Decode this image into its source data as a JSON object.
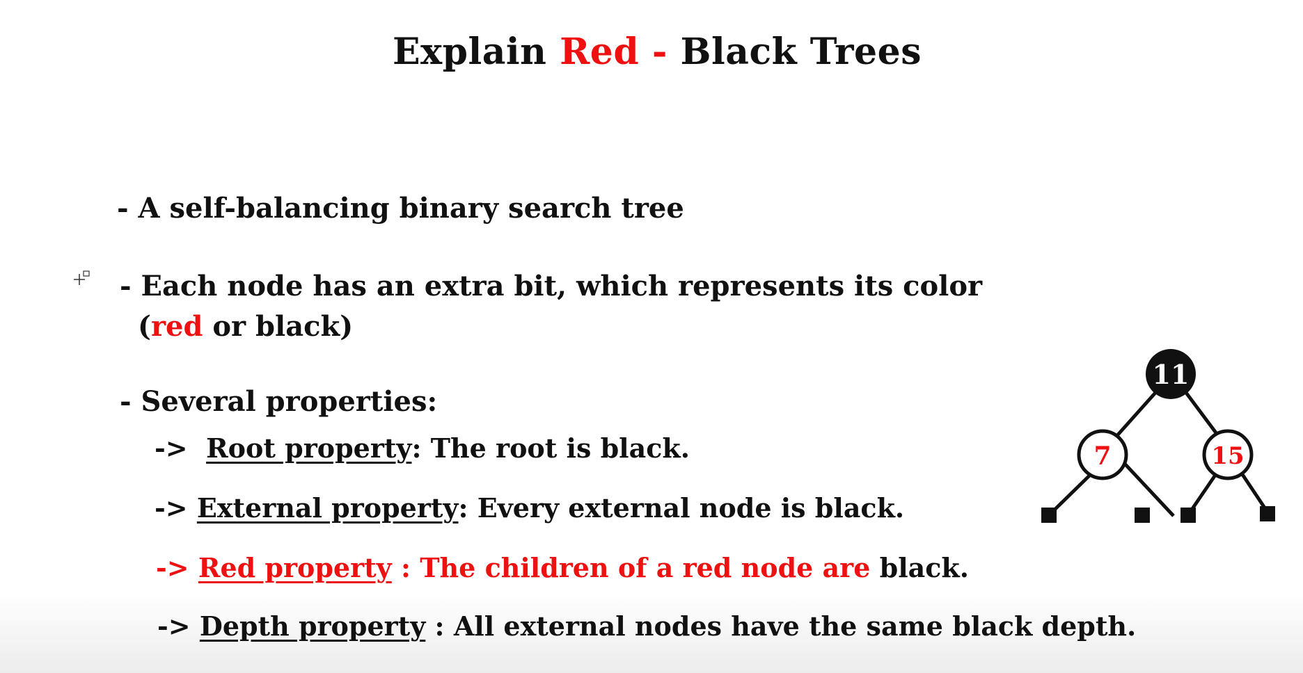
{
  "title": {
    "part1": "Explain ",
    "part2": "Red -",
    "part3": " Black Trees"
  },
  "bullets": {
    "b1": "- A self-balancing binary search tree",
    "b2": "- Each node has an extra bit, which represents its color",
    "b2_open": "(",
    "b2_red": "red",
    "b2_rest": " or black)",
    "b3": "- Several properties:"
  },
  "properties": [
    {
      "arrow": "->",
      "name": "Root property",
      "sep": ": ",
      "desc": "The root is black."
    },
    {
      "arrow": "->",
      "name": "External property",
      "sep": ": ",
      "desc": "Every external node is black."
    },
    {
      "arrow": "->",
      "name": "Red property",
      "sep": " : ",
      "desc": "The children of a red node are",
      "desc_black": " black."
    },
    {
      "arrow": "->",
      "name": "Depth property",
      "sep": " : ",
      "desc": "All external nodes have the same black depth."
    }
  ],
  "tree": {
    "root": {
      "label": "11",
      "color": "black"
    },
    "left": {
      "label": "7",
      "color": "red"
    },
    "right": {
      "label": "15",
      "color": "red"
    }
  },
  "colors": {
    "accent_red": "#ee1111",
    "text_black": "#111111"
  },
  "icons": [
    "move-cursor-icon"
  ]
}
